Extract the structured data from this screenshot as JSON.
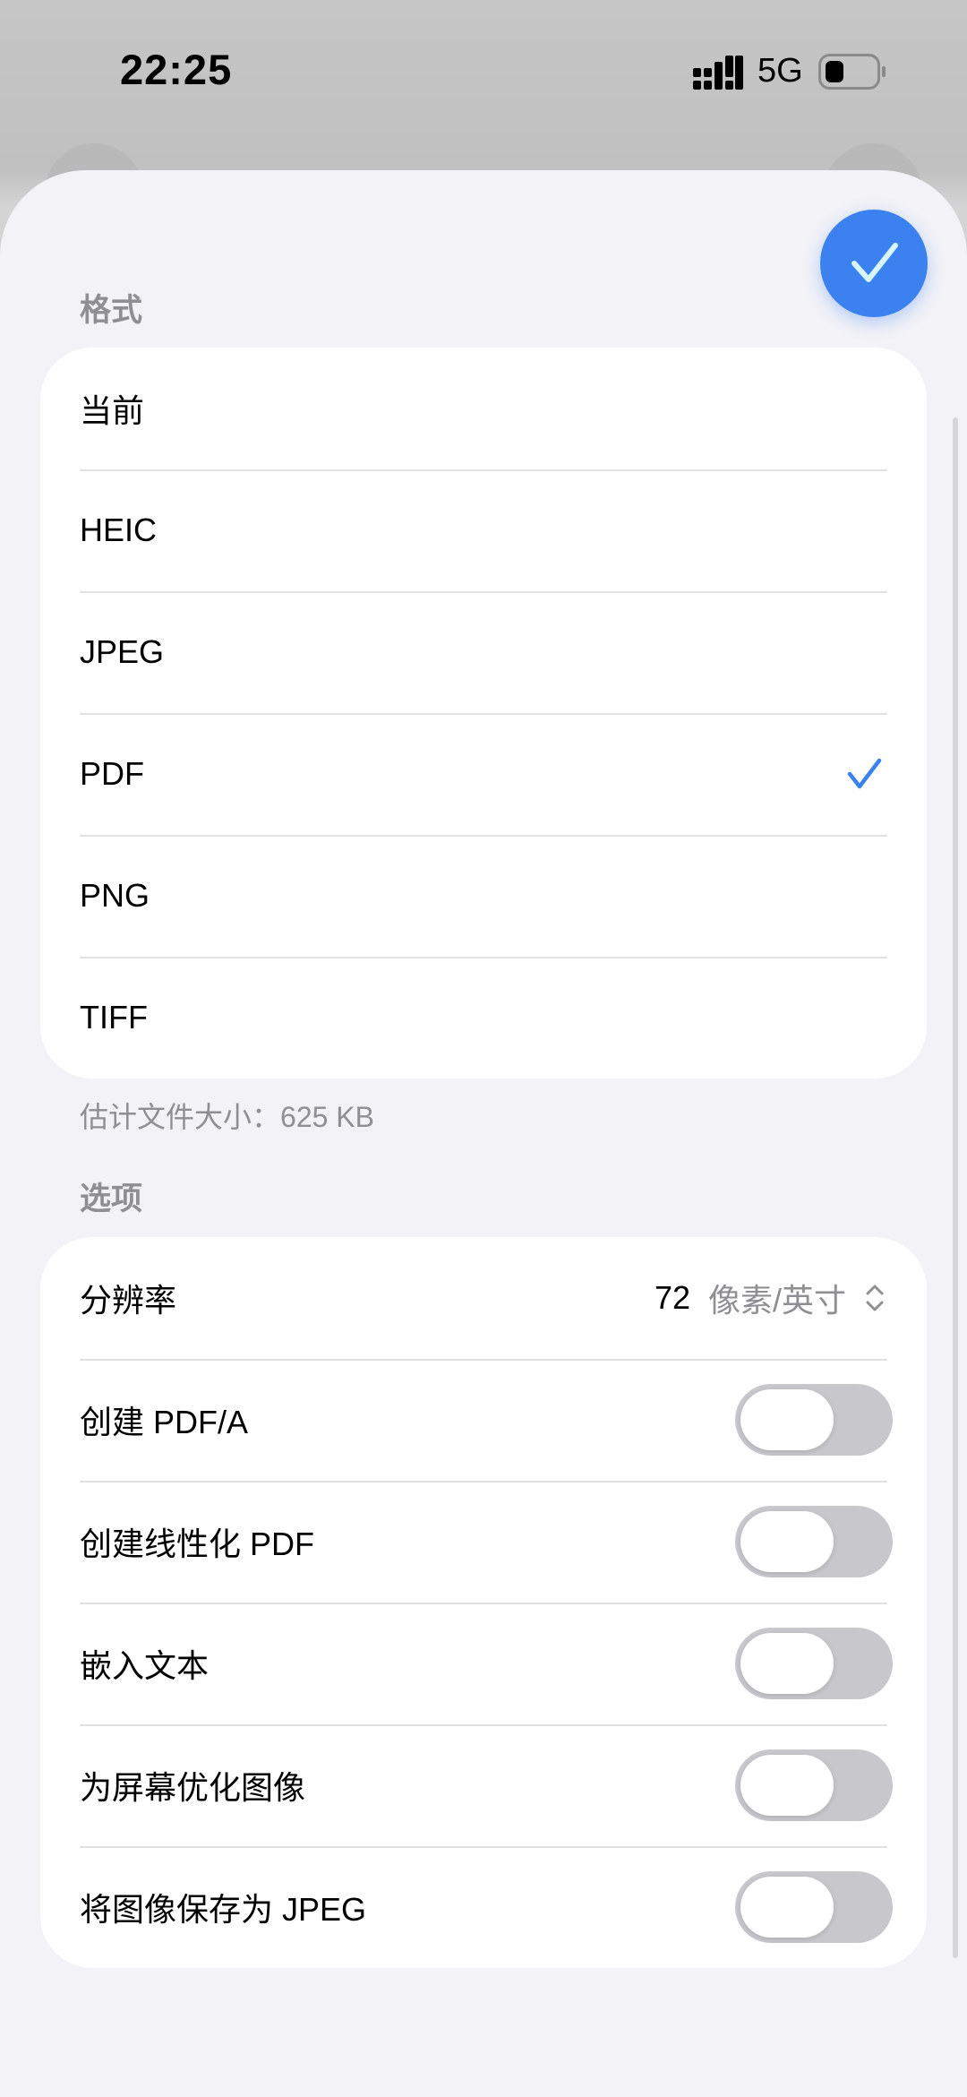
{
  "status_bar": {
    "time": "22:25",
    "network": "5G"
  },
  "format_section": {
    "header": "格式",
    "items": [
      {
        "label": "当前",
        "selected": false
      },
      {
        "label": "HEIC",
        "selected": false
      },
      {
        "label": "JPEG",
        "selected": false
      },
      {
        "label": "PDF",
        "selected": true
      },
      {
        "label": "PNG",
        "selected": false
      },
      {
        "label": "TIFF",
        "selected": false
      }
    ],
    "estimate_label": "估计文件大小：",
    "estimate_value": "625 KB"
  },
  "options_section": {
    "header": "选项",
    "resolution": {
      "label": "分辨率",
      "value": "72",
      "unit": "像素/英寸"
    },
    "toggles": [
      {
        "label": "创建 PDF/A",
        "on": false
      },
      {
        "label": "创建线性化 PDF",
        "on": false
      },
      {
        "label": "嵌入文本",
        "on": false
      },
      {
        "label": "为屏幕优化图像",
        "on": false
      },
      {
        "label": "将图像保存为 JPEG",
        "on": false
      }
    ]
  },
  "colors": {
    "accent": "#3b82f0",
    "sheet_bg": "#f2f2f7",
    "toggle_off": "#c7c7cc"
  },
  "icons": {
    "confirm": "checkmark-icon",
    "selected": "checkmark-icon",
    "stepper": "chevron-up-down-icon"
  }
}
